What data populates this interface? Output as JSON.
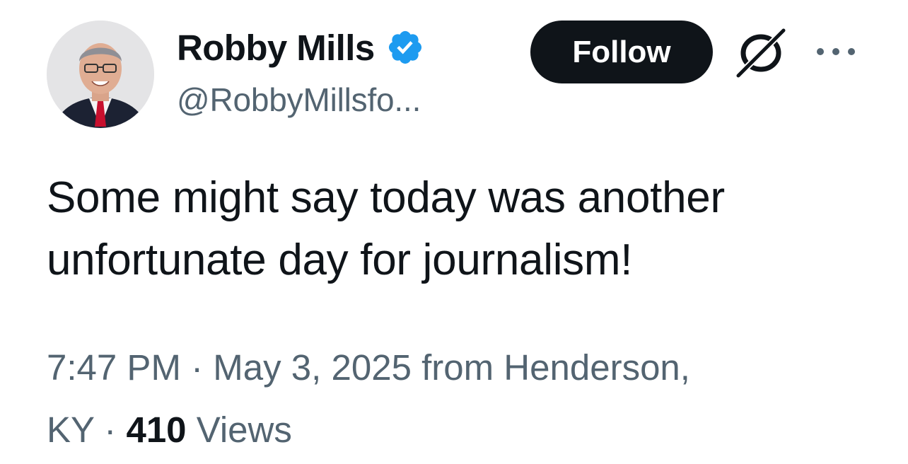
{
  "author": {
    "display_name": "Robby Mills",
    "handle": "@RobbyMillsfo...",
    "verified": true,
    "verified_color": "#1d9bf0"
  },
  "actions": {
    "follow_label": "Follow",
    "grok_icon": "grok-icon",
    "more_icon": "more-options-icon"
  },
  "tweet": {
    "text_line1": "Some might say today was another",
    "text_line2": "unfortunate day for journalism!"
  },
  "meta": {
    "time": "7:47 PM",
    "separator": "·",
    "date": "May 3, 2025",
    "location_prefix": "from Henderson,",
    "location_suffix": "KY",
    "views_count": "410",
    "views_label": "Views"
  },
  "colors": {
    "text_primary": "#0f1419",
    "text_secondary": "#536471",
    "button_bg": "#0f1419",
    "button_text": "#ffffff"
  }
}
